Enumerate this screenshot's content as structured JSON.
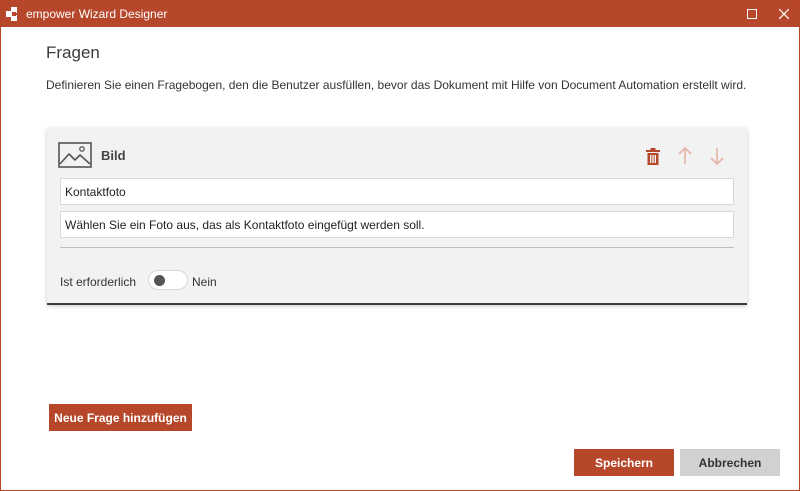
{
  "window": {
    "title": "empower Wizard Designer",
    "accent_color": "#b7472a"
  },
  "page": {
    "title": "Fragen",
    "description": "Definieren Sie einen Fragebogen, den die Benutzer ausfüllen, bevor das Dokument mit Hilfe von Document Automation erstellt wird."
  },
  "question_card": {
    "type_icon": "image-icon",
    "type_label": "Bild",
    "actions": {
      "delete_icon": "trash-icon",
      "move_up_icon": "arrow-up-icon",
      "move_down_icon": "arrow-down-icon"
    },
    "title_value": "Kontaktfoto",
    "description_value": "Wählen Sie ein Foto aus, das als Kontaktfoto eingefügt werden soll.",
    "required_label": "Ist erforderlich",
    "required_on": false,
    "required_state_label": "Nein"
  },
  "buttons": {
    "add_question": "Neue Frage hinzufügen",
    "save": "Speichern",
    "cancel": "Abbrechen"
  }
}
